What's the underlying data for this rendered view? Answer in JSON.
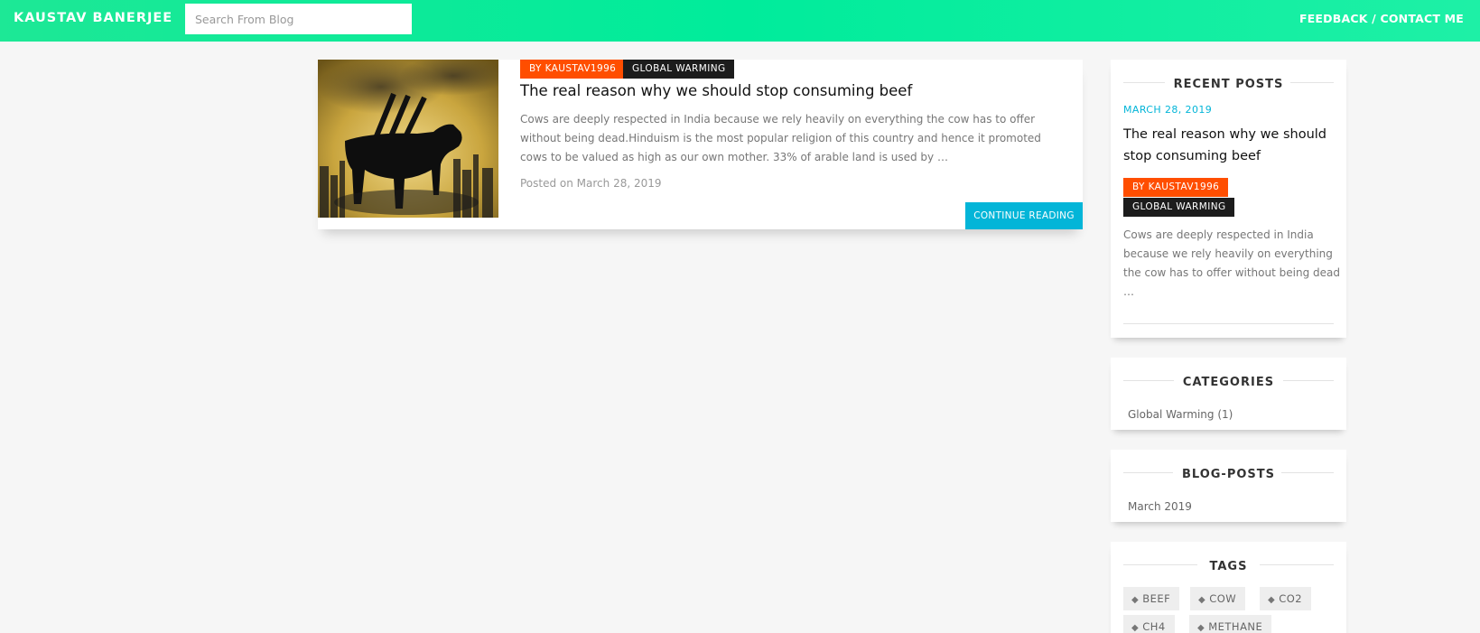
{
  "header": {
    "brand": "KAUSTAV BANERJEE",
    "search_placeholder": "Search From Blog",
    "nav_link": "FEEDBACK / CONTACT ME"
  },
  "post": {
    "author_badge": "BY KAUSTAV1996",
    "category_badge": "GLOBAL WARMING",
    "title": "The real reason why we should stop consuming beef",
    "excerpt": "Cows are deeply respected in India because we rely heavily on everything the cow has to offer without being dead.Hinduism is the most popular religion of this country and hence it promoted cows to be valued as high as our own mother. 33% of arable land is used by …",
    "date": "Posted on March 28, 2019",
    "continue_label": "CONTINUE READING"
  },
  "sidebar": {
    "recent": {
      "heading": "RECENT POSTS",
      "date": "MARCH 28, 2019",
      "title": "The real reason why we should stop consuming beef",
      "author_badge": "BY KAUSTAV1996",
      "category_badge": "GLOBAL WARMING",
      "excerpt": "Cows are deeply respected in India because we rely heavily on everything the cow has to offer without being dead …"
    },
    "categories": {
      "heading": "CATEGORIES",
      "items": [
        "Global Warming (1)"
      ]
    },
    "blog_posts": {
      "heading": "BLOG-POSTS",
      "items": [
        "March 2019"
      ]
    },
    "tags": {
      "heading": "TAGS",
      "items": [
        "BEEF",
        "COW",
        "CO2",
        "CH4",
        "METHANE"
      ]
    }
  },
  "colors": {
    "header_accent": "#00ec9b",
    "author_badge": "#ff4e00",
    "category_badge": "#1c1c1c",
    "link_accent": "#03b5d8"
  },
  "icons": {
    "tag": "tag-icon"
  }
}
